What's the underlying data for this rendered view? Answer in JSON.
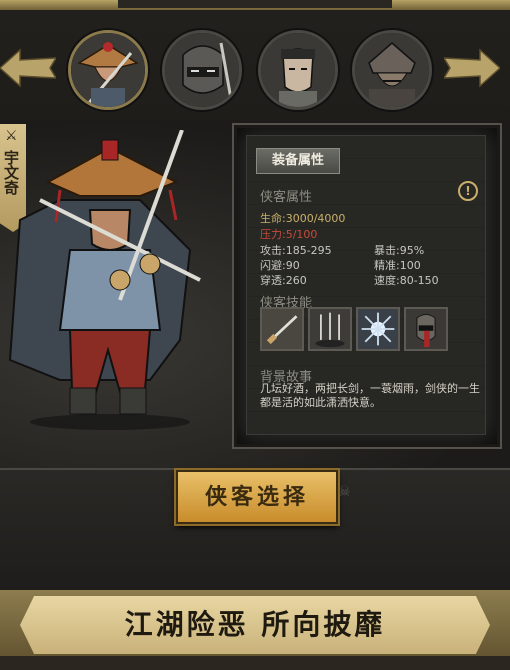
{
  "hero": {
    "name": "宇文奇",
    "name_icon": "crossed-swords-icon"
  },
  "portraits": [
    {
      "name": "straw-hat-swordsman",
      "active": true
    },
    {
      "name": "masked-ninja",
      "active": false
    },
    {
      "name": "headband-scholar",
      "active": false
    },
    {
      "name": "armored-general",
      "active": false
    }
  ],
  "panel": {
    "tab_label": "装备属性",
    "section_attributes": "侠客属性",
    "stats": {
      "hp_label": "生命:",
      "hp_value": "3000/4000",
      "stress_label": "压力:",
      "stress_value": "5/100",
      "attack_label": "攻击:",
      "attack_value": "185-295",
      "crit_label": "暴击:",
      "crit_value": "95%",
      "dodge_label": "闪避:",
      "dodge_value": "90",
      "accuracy_label": "精准:",
      "accuracy_value": "100",
      "pierce_label": "穿透:",
      "pierce_value": "260",
      "speed_label": "速度:",
      "speed_value": "80-150"
    },
    "section_skills": "侠客技能",
    "skills": [
      "sword-slash-skill",
      "sword-rain-skill",
      "blade-burst-skill",
      "shadow-strike-skill"
    ],
    "section_story": "背景故事",
    "story": "几坛好酒，两把长剑，一蓑烟雨，剑侠的一生都是活的如此潇洒快意。"
  },
  "select_button": "侠客选择",
  "slogan": "江湖险恶  所向披靡",
  "colors": {
    "gold": "#c9b06a",
    "stress": "#c84a3a",
    "button": "#e0b055"
  }
}
